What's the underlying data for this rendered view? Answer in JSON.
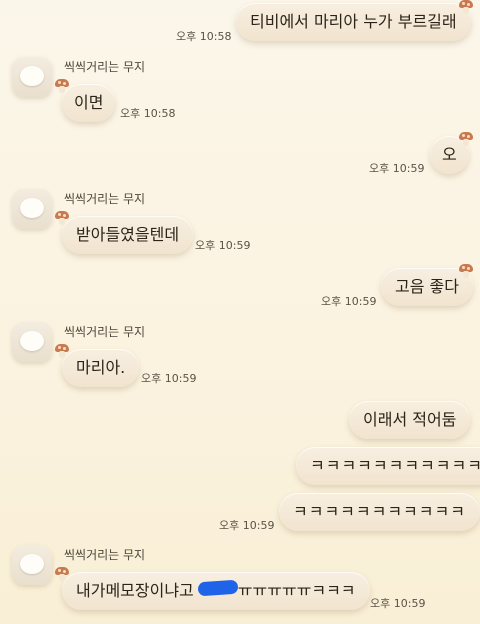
{
  "chat": {
    "participant": "씩씩거리는 무지",
    "messages": [
      {
        "side": "out",
        "text": "티비에서 마리아 누가 부르길래",
        "time": "오후 10:58"
      },
      {
        "side": "in",
        "text": "이면",
        "time": "오후 10:58"
      },
      {
        "side": "out",
        "text": "오",
        "time": "오후 10:59"
      },
      {
        "side": "in",
        "text": "받아들였을텐데",
        "time": "오후 10:59"
      },
      {
        "side": "out",
        "text": "고음 좋다",
        "time": "오후 10:59"
      },
      {
        "side": "in",
        "text": "마리아.",
        "time": "오후 10:59"
      },
      {
        "side": "out",
        "text": "이래서 적어둠",
        "time": ""
      },
      {
        "side": "out",
        "text": "ㅋㅋㅋㅋㅋㅋㅋㅋㅋㅋㅋ",
        "time": ""
      },
      {
        "side": "out",
        "text": "ㅋㅋㅋㅋㅋㅋㅋㅋㅋㅋㅋ",
        "time": "오후 10:59"
      },
      {
        "side": "in",
        "text": "내가메모장이냐고",
        "text_suffix": "ㅠㅠㅠㅠㅠㅋㅋㅋ",
        "time": "오후 10:59"
      }
    ]
  },
  "colors": {
    "background": "#fbf3e0",
    "bubble": "#f4e9d6",
    "mushroom": "#c9794e",
    "redaction": "#1f63e8"
  },
  "icons": {
    "avatar": "muji-avatar-icon",
    "bubble_decoration": "mushroom-icon"
  }
}
